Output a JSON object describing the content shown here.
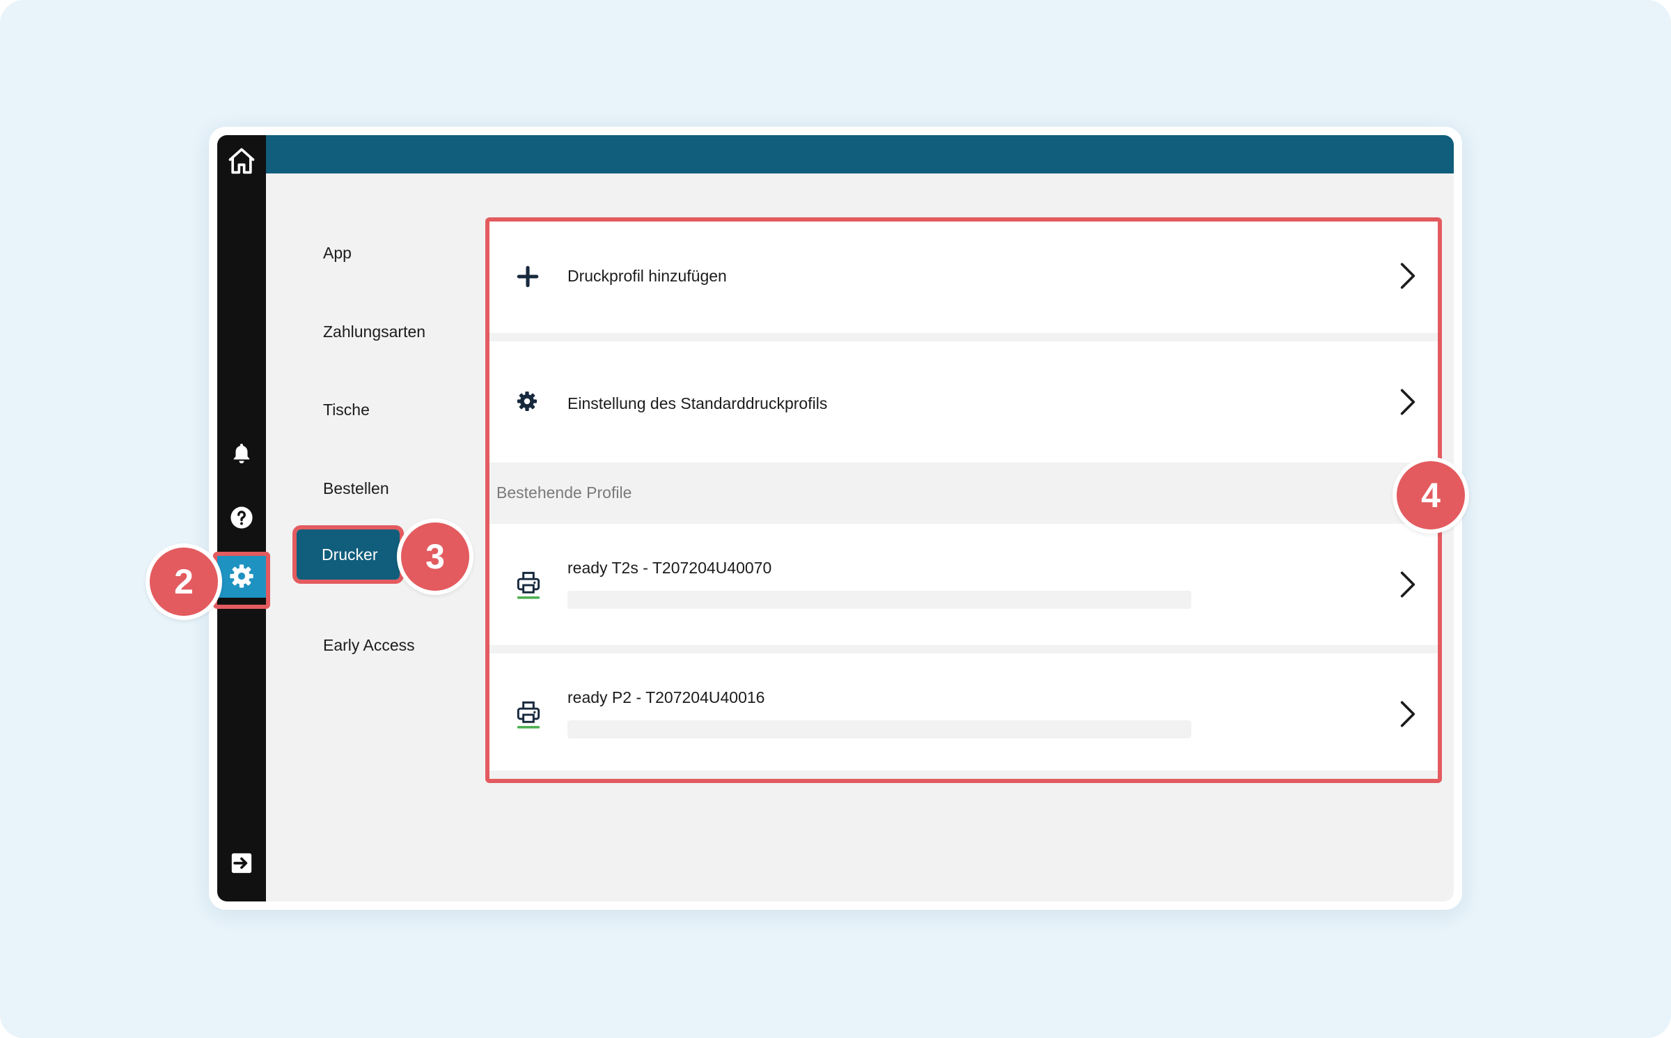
{
  "sidebar": {
    "icons": {
      "home": "home-icon",
      "notifications": "bell-icon",
      "help": "question-icon",
      "settings": "gear-icon",
      "logout": "logout-icon"
    },
    "active_color": "#1e92c1",
    "background": "#111111"
  },
  "topbar": {
    "color": "#115e7c"
  },
  "submenu": {
    "items": [
      {
        "label": "App"
      },
      {
        "label": "Zahlungsarten"
      },
      {
        "label": "Tische"
      },
      {
        "label": "Bestellen"
      },
      {
        "label": "Drucker",
        "active": true
      },
      {
        "label": "Early Access"
      }
    ]
  },
  "printer_settings": {
    "add_profile_label": "Druckprofil hinzufügen",
    "default_profile_label": "Einstellung des Standarddruckprofils",
    "section_header": "Bestehende Profile",
    "profiles": [
      {
        "name": "ready T2s - T207204U40070"
      },
      {
        "name": "ready P2 - T207204U40016"
      }
    ]
  },
  "annotations": {
    "badges": [
      "2",
      "3",
      "4"
    ],
    "highlight_color": "#e35b5f"
  }
}
